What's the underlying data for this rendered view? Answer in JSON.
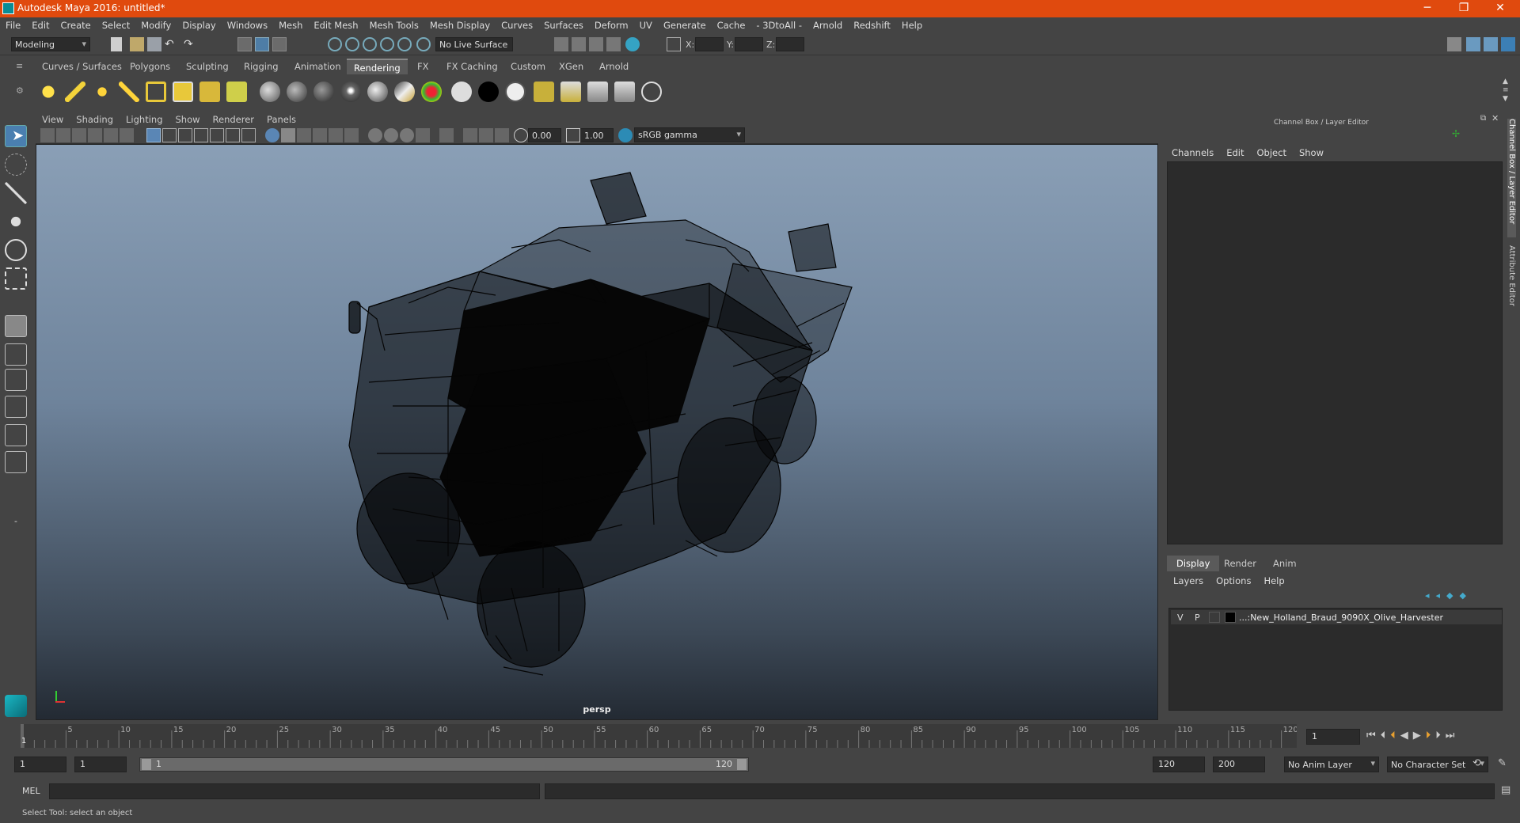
{
  "window": {
    "title": "Autodesk Maya 2016: untitled*",
    "minimize": "─",
    "maximize": "❐",
    "close": "✕"
  },
  "menubar": [
    "File",
    "Edit",
    "Create",
    "Select",
    "Modify",
    "Display",
    "Windows",
    "Mesh",
    "Edit Mesh",
    "Mesh Tools",
    "Mesh Display",
    "Curves",
    "Surfaces",
    "Deform",
    "UV",
    "Generate",
    "Cache",
    "- 3DtoAll -",
    "Arnold",
    "Redshift",
    "Help"
  ],
  "statusline": {
    "workspace": "Modeling",
    "live_surface": "No Live Surface",
    "x_label": "X:",
    "y_label": "Y:",
    "z_label": "Z:"
  },
  "shelf_tabs": [
    "Curves / Surfaces",
    "Polygons",
    "Sculpting",
    "Rigging",
    "Animation",
    "Rendering",
    "FX",
    "FX Caching",
    "Custom",
    "XGen",
    "Arnold"
  ],
  "shelf_active": "Rendering",
  "viewport": {
    "menu": [
      "View",
      "Shading",
      "Lighting",
      "Show",
      "Renderer",
      "Panels"
    ],
    "exposure": "0.00",
    "gamma": "1.00",
    "colorspace": "sRGB gamma",
    "camera_label": "persp"
  },
  "right_panel": {
    "header": "Channel Box / Layer Editor",
    "channel_menu": [
      "Channels",
      "Edit",
      "Object",
      "Show"
    ],
    "layer_tabs": [
      "Display",
      "Render",
      "Anim"
    ],
    "layer_tab_active": "Display",
    "layer_menu": [
      "Layers",
      "Options",
      "Help"
    ],
    "layer_row": {
      "v": "V",
      "p": "P",
      "name": "...:New_Holland_Braud_9090X_Olive_Harvester"
    },
    "side_tabs": [
      "Channel Box / Layer Editor",
      "Attribute Editor"
    ]
  },
  "timeline": {
    "ticks": [
      "5",
      "10",
      "15",
      "20",
      "25",
      "30",
      "35",
      "40",
      "45",
      "50",
      "55",
      "60",
      "65",
      "70",
      "75",
      "80",
      "85",
      "90",
      "95",
      "100",
      "105",
      "110",
      "115",
      "120"
    ],
    "start_marker": "1",
    "current_frame": "1"
  },
  "range": {
    "start": "1",
    "playback_start": "1",
    "slider_start": "1",
    "slider_end": "120",
    "playback_end": "120",
    "end": "200",
    "anim_layer": "No Anim Layer",
    "character_set": "No Character Set"
  },
  "cmdline": {
    "label": "MEL"
  },
  "helpline": {
    "text": "Select Tool: select an object"
  }
}
